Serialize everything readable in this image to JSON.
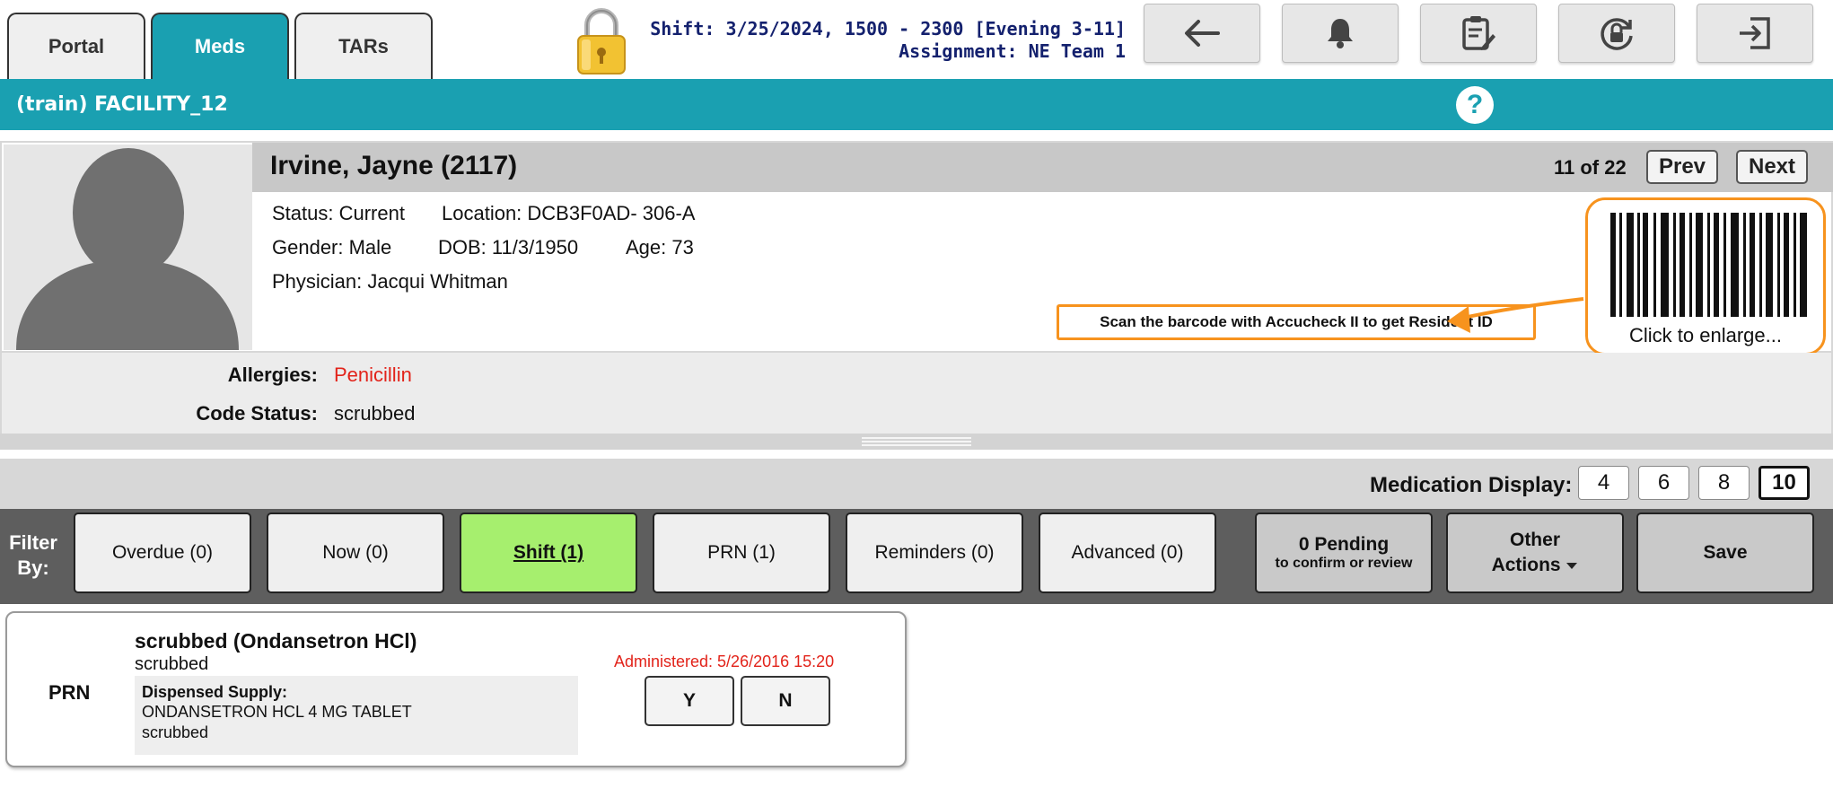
{
  "tabs": [
    {
      "label": "Portal"
    },
    {
      "label": "Meds"
    },
    {
      "label": "TARs"
    }
  ],
  "active_tab": "Meds",
  "shift": {
    "line1": "Shift: 3/25/2024, 1500 - 2300 [Evening 3-11]",
    "line2": "Assignment: NE Team 1"
  },
  "toolbar_icons": [
    "back-arrow-icon",
    "bell-icon",
    "clipboard-edit-icon",
    "rotate-lock-icon",
    "logout-icon"
  ],
  "facility": {
    "name": "(train) FACILITY_12",
    "help_label": "?"
  },
  "resident": {
    "name": "Irvine, Jayne (2117)",
    "counter": "11 of 22",
    "prev_label": "Prev",
    "next_label": "Next",
    "status": "Status: Current",
    "location": "Location: DCB3F0AD- 306-A",
    "gender": "Gender: Male",
    "dob": "DOB: 11/3/1950",
    "age": "Age: 73",
    "physician": "Physician: Jacqui Whitman",
    "scan_hint": "Scan the barcode with Accucheck II to get Resident ID",
    "barcode_caption": "Click to enlarge...",
    "allergies_label": "Allergies:",
    "allergies_value": "Penicillin",
    "code_status_label": "Code Status:",
    "code_status_value": "scrubbed"
  },
  "medication_display": {
    "label": "Medication Display:",
    "options": [
      "4",
      "6",
      "8",
      "10"
    ],
    "selected": "10"
  },
  "filters": {
    "label": "Filter By:",
    "buttons": [
      {
        "label": "Overdue (0)"
      },
      {
        "label": "Now (0)"
      },
      {
        "label": "Shift (1)"
      },
      {
        "label": "PRN (1)"
      },
      {
        "label": "Reminders (0)"
      },
      {
        "label": "Advanced (0)"
      }
    ],
    "active": "Shift (1)",
    "pending_main": "0 Pending",
    "pending_sub": "to confirm or review",
    "other_actions_l1": "Other",
    "other_actions_l2": "Actions",
    "save_label": "Save"
  },
  "medications": [
    {
      "type": "PRN",
      "name": "scrubbed (Ondansetron HCl)",
      "sub": "scrubbed",
      "supply_heading": "Dispensed Supply:",
      "supply_line1": "ONDANSETRON HCL 4 MG TABLET",
      "supply_line2": "scrubbed",
      "administered": "Administered: 5/26/2016 15:20",
      "yes_label": "Y",
      "no_label": "N"
    }
  ],
  "colors": {
    "teal": "#1aa0b1",
    "active_filter": "#a6ef6e",
    "allergy_red": "#e2231a",
    "callout_orange": "#f7931e",
    "shift_navy": "#14216e"
  }
}
